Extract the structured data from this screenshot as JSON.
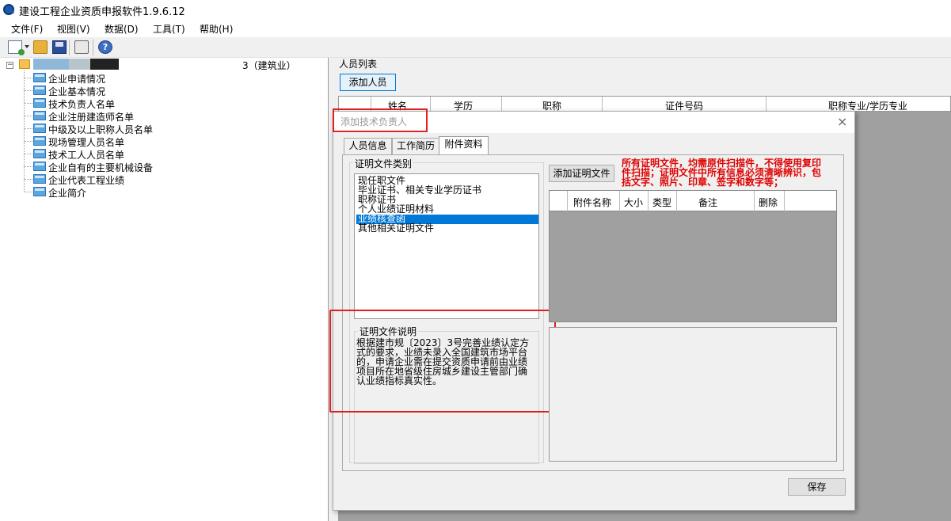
{
  "window": {
    "title": "建设工程企业资质申报软件1.9.6.12"
  },
  "menu": [
    "文件(F)",
    "视图(V)",
    "数据(D)",
    "工具(T)",
    "帮助(H)"
  ],
  "toolbar": {
    "icons": [
      "new-icon",
      "open-folder-icon",
      "save-icon",
      "print-icon",
      "help-icon"
    ]
  },
  "tree": {
    "root_label_suffix": "3（建筑业）",
    "items": [
      "企业申请情况",
      "企业基本情况",
      "技术负责人名单",
      "企业注册建造师名单",
      "中级及以上职称人员名单",
      "现场管理人员名单",
      "技术工人人员名单",
      "企业自有的主要机械设备",
      "企业代表工程业绩",
      "企业简介"
    ]
  },
  "people": {
    "group_caption": "人员列表",
    "add_button": "添加人员",
    "columns": [
      "姓名",
      "学历",
      "职称",
      "证件号码",
      "职称专业/学历专业"
    ]
  },
  "dialog": {
    "title": "添加技术负责人",
    "close": "×",
    "tabs": [
      "人员信息",
      "工作简历",
      "附件资料"
    ],
    "active_tab": 2,
    "category_group": "证明文件类别",
    "categories": [
      "现任职文件",
      "毕业证书、相关专业学历证书",
      "职称证书",
      "个人业绩证明材料",
      "业绩核查函",
      "其他相关证明文件"
    ],
    "selected_category": 4,
    "desc_group": "证明文件说明",
    "desc_text": "根据建市规〔2023〕3号完善业绩认定方式的要求，业绩未录入全国建筑市场平台的，申请企业需在提交资质申请前由业绩项目所在地省级住房城乡建设主管部门确认业绩指标真实性。",
    "add_file_button": "添加证明文件",
    "warning": "所有证明文件，均需原件扫描件，不得使用复印件扫描；证明文件中所有信息必须清晰辨识，包括文字、照片、印章、签字和数字等；",
    "attach_columns": [
      "附件名称",
      "大小",
      "类型",
      "备注",
      "删除"
    ],
    "save_button": "保存"
  },
  "colors": {
    "selection": "#0078d7",
    "annotation_red": "#e02020",
    "warning_text": "#e00000"
  }
}
